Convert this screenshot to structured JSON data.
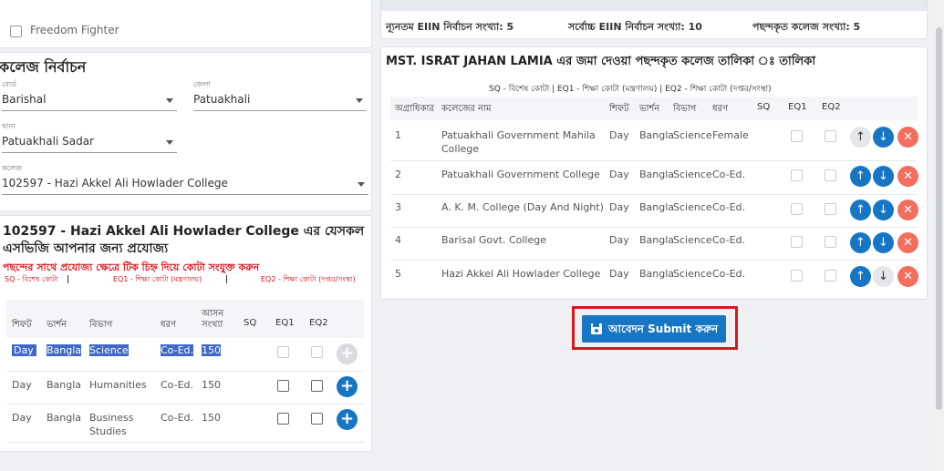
{
  "left": {
    "freedom_fighter_label": "Freedom Fighter",
    "section_title": "কলেজ নির্বাচন",
    "board": {
      "label": "বোর্ড",
      "value": "Barishal"
    },
    "district": {
      "label": "জেলা",
      "value": "Patuakhali"
    },
    "thana": {
      "label": "থানা",
      "value": "Patuakhali Sadar"
    },
    "college": {
      "label": "কলেজ",
      "value": "102597 - Hazi Akkel Ali Howlader College"
    },
    "sqv_title_line1": "102597 - Hazi Akkel Ali Howlader College এর যেসকল",
    "sqv_title_line2": "এসভিজি আপনার জন্য প্রযোজ্য",
    "quota_instruction": "পছন্দের সাথে প্রযোজ্য ক্ষেত্রে টিক চিহ্ন দিয়ে কোটা সংযুক্ত করুন",
    "legend_sq": "SQ - বিশেষ কোটা",
    "legend_eq1": "EQ1 - শিক্ষা কোটা (মন্ত্রণালয়)",
    "legend_eq2": "EQ2 - শিক্ষা কোটা (দপ্তর/সংস্থা)",
    "headers": {
      "shift": "শিফট",
      "version": "ভার্শন",
      "group": "বিভাগ",
      "type": "ধরণ",
      "seats_line1": "আসন",
      "seats_line2": "সংখ্যা",
      "sq": "SQ",
      "eq1": "EQ1",
      "eq2": "EQ2"
    },
    "rows": [
      {
        "shift": "Day",
        "version": "Bangla",
        "group": "Science",
        "type": "Co-Ed.",
        "seats": "150"
      },
      {
        "shift": "Day",
        "version": "Bangla",
        "group": "Humanities",
        "type": "Co-Ed.",
        "seats": "150"
      },
      {
        "shift": "Day",
        "version": "Bangla",
        "group_line1": "Business",
        "group_line2": "Studies",
        "type": "Co-Ed.",
        "seats": "150"
      }
    ],
    "add_symbol": "+"
  },
  "right": {
    "min_eiin": "ন্যূনতম EIIN নির্বাচন সংখ্যা: 5",
    "max_eiin": "সর্বোচ্চ EIIN নির্বাচন সংখ্যা: 10",
    "selected_count": "পছন্দকৃত কলেজ সংখ্যা: 5",
    "list_title": "MST. ISRAT JAHAN LAMIA  এর জমা দেওয়া পছন্দকৃত কলেজ তালিকা  ঃ তালিকা",
    "legend": "SQ - বিশেষ কোটা  | EQ1 - শিক্ষা কোটা (মন্ত্রণালয়)  | EQ2 - শিক্ষা কোটা (দপ্তর/সংস্থা)",
    "headers": {
      "priority": "অগ্রাধিকার",
      "college": "কলেজের নাম",
      "shift": "শিফট",
      "version": "ভার্শন",
      "group": "বিভাগ",
      "type": "ধরণ",
      "sq": "SQ",
      "eq1": "EQ1",
      "eq2": "EQ2"
    },
    "rows": [
      {
        "priority": "1",
        "college_line1": "Patuakhali Government Mahila",
        "college_line2": "College",
        "shift": "Day",
        "version": "Bangla",
        "group": "Science",
        "type": "Female"
      },
      {
        "priority": "2",
        "college_line1": "Patuakhali Government College",
        "shift": "Day",
        "version": "Bangla",
        "group": "Science",
        "type": "Co-Ed."
      },
      {
        "priority": "3",
        "college_line1": "A. K. M. College (Day And Night)",
        "shift": "Day",
        "version": "Bangla",
        "group": "Science",
        "type": "Co-Ed."
      },
      {
        "priority": "4",
        "college_line1": "Barisal Govt. College",
        "shift": "Day",
        "version": "Bangla",
        "group": "Science",
        "type": "Co-Ed."
      },
      {
        "priority": "5",
        "college_line1": "Hazi Akkel Ali Howlader College",
        "shift": "Day",
        "version": "Bangla",
        "group": "Science",
        "type": "Co-Ed."
      }
    ],
    "up_symbol": "↑",
    "down_symbol": "↓",
    "remove_symbol": "✕",
    "submit_label": "আবেদন Submit করুন"
  },
  "colors": {
    "primary": "#1676c4",
    "danger": "#f46e5f",
    "highlight": "#3f68c8",
    "annotation": "#d9161c",
    "quota_text": "#d9161c"
  }
}
